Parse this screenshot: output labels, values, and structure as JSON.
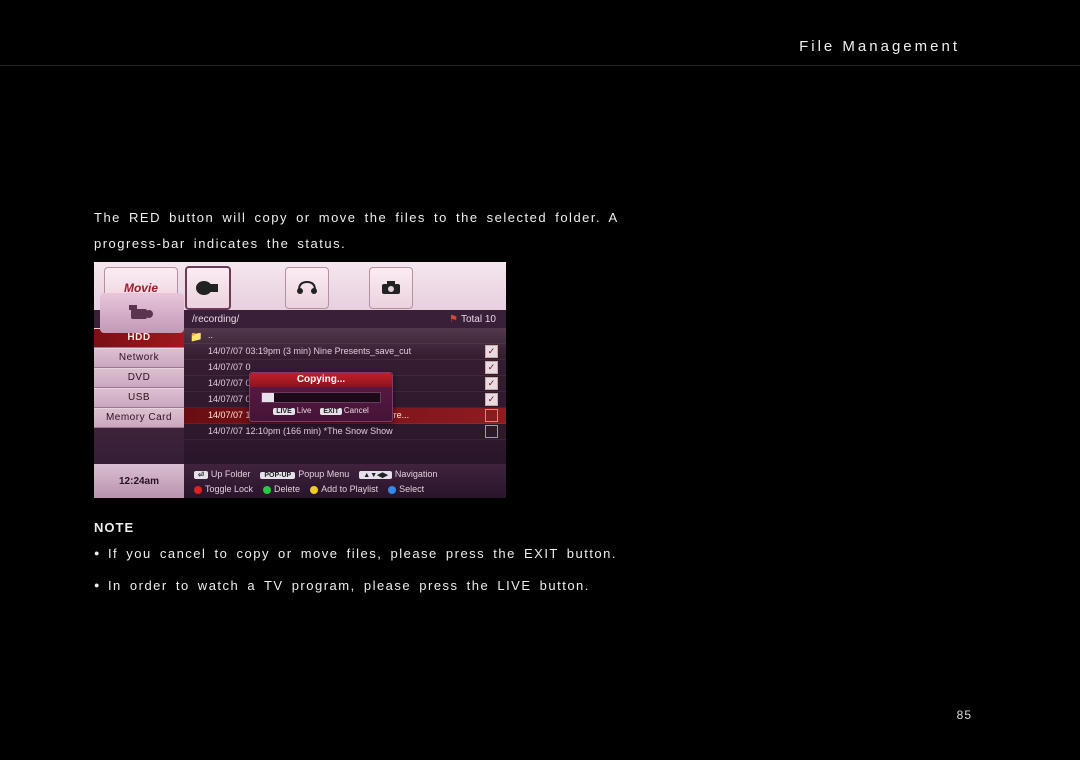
{
  "header": {
    "title": "File Management"
  },
  "intro": "The RED button will copy or move the files to the selected folder. A progress-bar indicates the status.",
  "note": {
    "heading": "NOTE",
    "items": [
      "If you cancel to copy or move files, please press the EXIT button.",
      "In order to watch a TV program, please press the LIVE button."
    ]
  },
  "page_number": "85",
  "shot": {
    "tab_label": "Movie",
    "path": "/recording/",
    "total_label": "Total 10",
    "sidebar": [
      "HDD",
      "Network",
      "DVD",
      "USB",
      "Memory Card"
    ],
    "sidebar_selected": 0,
    "clock": "12:24am",
    "rows": [
      {
        "text": "..",
        "folder": true
      },
      {
        "text": "14/07/07 03:19pm (3 min) Nine Presents_save_cut",
        "checked": true
      },
      {
        "text": "14/07/07 0",
        "checked": true
      },
      {
        "text": "14/07/07 0",
        "checked": true
      },
      {
        "text": "14/07/07 0",
        "checked": true
      },
      {
        "text": "14/07/07 12:10pm (167 min) *Motor Sport: Carre...",
        "checked": false,
        "hi": true
      },
      {
        "text": "14/07/07 12:10pm (166 min) *The Snow Show",
        "checked": false
      }
    ],
    "dialog": {
      "title": "Copying...",
      "live_key": "LIVE",
      "live_label": "Live",
      "exit_key": "EXIT",
      "exit_label": "Cancel"
    },
    "footer1": [
      {
        "key": "⏎",
        "label": "Up Folder"
      },
      {
        "key": "POP-UP",
        "label": "Popup Menu"
      },
      {
        "key": "▲▼◀▶",
        "label": "Navigation"
      }
    ],
    "footer2": [
      {
        "color": "red",
        "label": "Toggle Lock"
      },
      {
        "color": "green",
        "label": "Delete"
      },
      {
        "color": "yellow",
        "label": "Add to Playlist"
      },
      {
        "color": "blue",
        "label": "Select"
      }
    ]
  }
}
